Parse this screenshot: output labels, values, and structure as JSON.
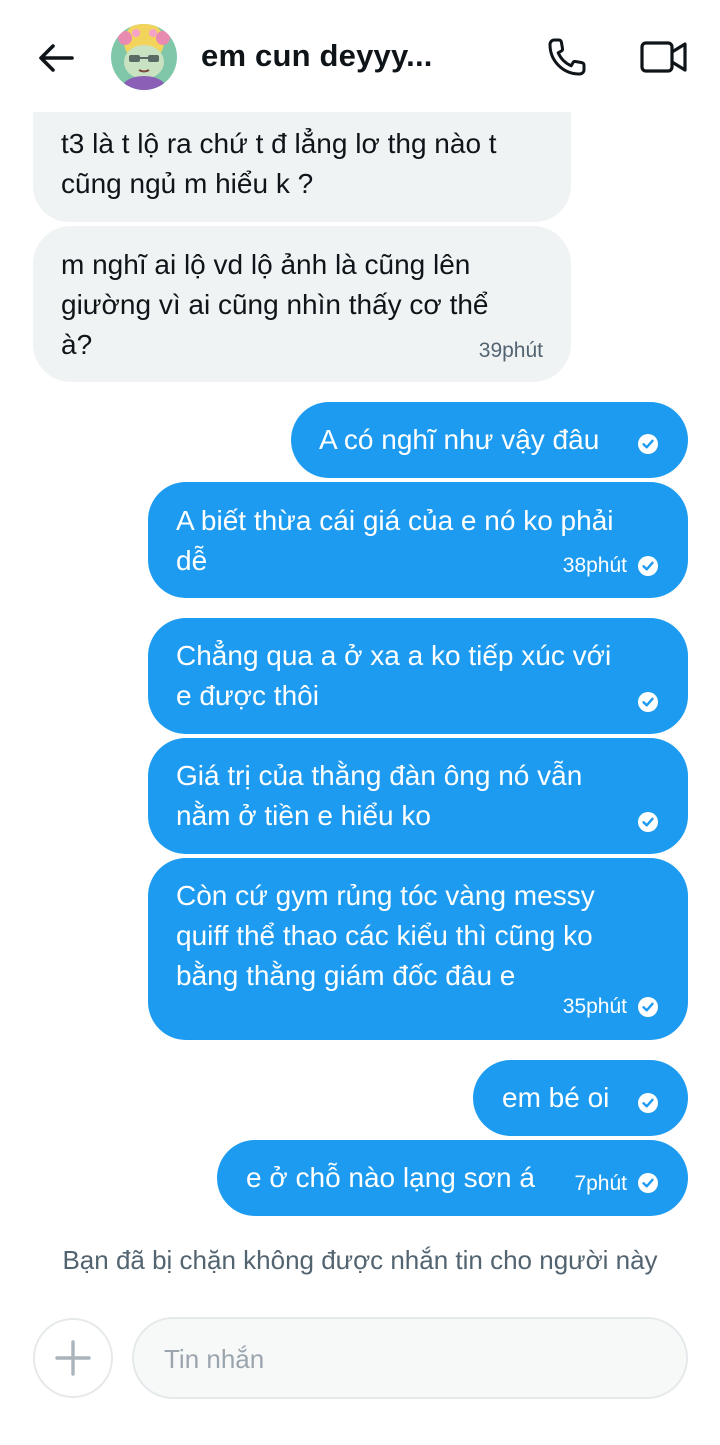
{
  "header": {
    "title": "em cun deyyy...",
    "back_icon": "arrow-left-icon",
    "call_icon": "phone-icon",
    "video_icon": "video-camera-icon"
  },
  "messages": [
    {
      "direction": "incoming",
      "text": "t3 là t lộ ra chứ t đ lẳng lơ thg nào t\ncũng ngủ m hiểu k ?"
    },
    {
      "direction": "incoming",
      "text": "m nghĩ ai lộ vd lộ ảnh là cũng lên\ngiường vì ai cũng nhìn thấy cơ thể\nà?",
      "time": "39phút"
    },
    {
      "direction": "outgoing",
      "text": "A có nghĩ như vậy đâu",
      "read": true
    },
    {
      "direction": "outgoing",
      "text": "A biết thừa cái giá của e nó ko phải\ndễ",
      "time": "38phút",
      "read": true
    },
    {
      "direction": "outgoing",
      "text": "Chẳng qua a ở xa a ko tiếp xúc với\ne được thôi",
      "read": true
    },
    {
      "direction": "outgoing",
      "text": "Giá trị của thằng đàn ông nó vẫn\nnằm ở tiền e hiểu ko",
      "read": true
    },
    {
      "direction": "outgoing",
      "text": "Còn cứ gym rủng tóc vàng messy\nquiff thể thao các kiểu thì cũng ko\nbằng thằng giám đốc đâu e",
      "time": "35phút",
      "read": true
    },
    {
      "direction": "outgoing",
      "text": "em bé oi",
      "read": true
    },
    {
      "direction": "outgoing",
      "text": "e ở chỗ nào lạng sơn á",
      "time": "7phút",
      "read": true
    }
  ],
  "footer": {
    "blocked_notice": "Bạn đã bị chặn không được nhắn tin cho người này",
    "composer_placeholder": "Tin nhắn",
    "plus_icon": "plus-icon"
  },
  "colors": {
    "outgoing_bubble": "#1d9bf0",
    "incoming_bubble": "#eff3f4",
    "text_primary": "#0f1419",
    "text_secondary": "#536471"
  }
}
